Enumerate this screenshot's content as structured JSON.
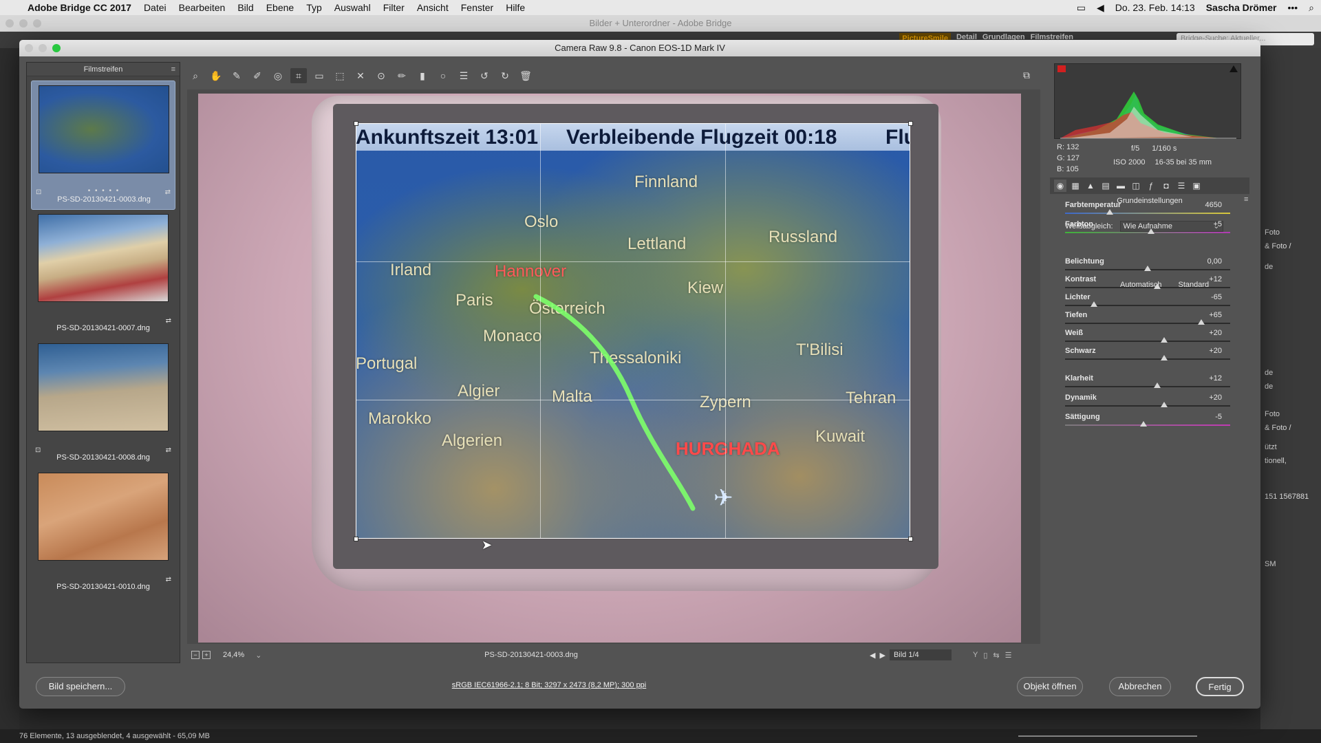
{
  "menubar": {
    "app_name": "Adobe Bridge CC 2017",
    "menus": [
      "Datei",
      "Bearbeiten",
      "Bild",
      "Ebene",
      "Typ",
      "Auswahl",
      "Filter",
      "Ansicht",
      "Fenster",
      "Hilfe"
    ],
    "datetime": "Do. 23. Feb. 14:13",
    "user": "Sascha Drömer"
  },
  "bridge": {
    "window_title": "Bilder + Unterordner - Adobe Bridge",
    "workspaces": [
      "PictureSmile",
      "Detail",
      "Grundlagen",
      "Filmstreifen"
    ],
    "search_placeholder": "Bridge-Suche: Aktueller...",
    "status_text": "76 Elemente, 13 ausgeblendet, 4 ausgewählt - 65,09 MB",
    "right_items": [
      "Foto",
      "& Foto /",
      "de",
      "de",
      "de",
      "Foto",
      "& Foto /",
      "ützt",
      "tionell,",
      "151 1567881",
      "SM"
    ]
  },
  "camera_raw": {
    "window_title": "Camera Raw 9.8 - Canon EOS-1D Mark IV",
    "filmstrip": {
      "title": "Filmstreifen",
      "items": [
        {
          "filename": "PS-SD-20130421-0003.dng",
          "dots": "• • • • •"
        },
        {
          "filename": "PS-SD-20130421-0007.dng"
        },
        {
          "filename": "PS-SD-20130421-0008.dng"
        },
        {
          "filename": "PS-SD-20130421-0010.dng"
        }
      ]
    },
    "preview": {
      "map_header_left": "Ankunftszeit 13:01",
      "map_header_right": "Verbleibende Flugzeit 00:18",
      "map_header_cut": "Flu",
      "labels": [
        "Finnland",
        "Oslo",
        "Lettland",
        "Russland",
        "Irland",
        "Hannover",
        "Paris",
        "Österreich",
        "Kiew",
        "Monaco",
        "Thessaloniki",
        "T'Bilisi",
        "Portugal",
        "Algier",
        "Malta",
        "Zypern",
        "Tehran",
        "Marokko",
        "Algerien",
        "HURGHADA",
        "Kuwait"
      ]
    },
    "status": {
      "zoom": "24,4%",
      "filename": "PS-SD-20130421-0003.dng",
      "image_counter": "Bild 1/4"
    },
    "bottom": {
      "save_label": "Bild speichern...",
      "workflow_options": "sRGB IEC61966-2.1; 8 Bit; 3297 x 2473 (8,2 MP); 300 ppi",
      "open_label": "Objekt öffnen",
      "cancel_label": "Abbrechen",
      "done_label": "Fertig"
    },
    "readout": {
      "r": "R:  132",
      "g": "G:  127",
      "b": "B:  105",
      "aperture": "f/5",
      "shutter": "1/160 s",
      "iso": "ISO 2000",
      "lens": "16-35 bei 35 mm"
    },
    "panel": {
      "title": "Grundeinstellungen",
      "wb_label": "Weißabgleich:",
      "wb_value": "Wie Aufnahme",
      "auto_label": "Automatisch",
      "default_label": "Standard",
      "sliders": [
        {
          "label": "Farbtemperatur",
          "value": "4650",
          "pos": 0.27
        },
        {
          "label": "Farbton",
          "value": "+5",
          "pos": 0.52
        },
        {
          "label": "Belichtung",
          "value": "0,00",
          "pos": 0.5
        },
        {
          "label": "Kontrast",
          "value": "+12",
          "pos": 0.56
        },
        {
          "label": "Lichter",
          "value": "-65",
          "pos": 0.175
        },
        {
          "label": "Tiefen",
          "value": "+65",
          "pos": 0.825
        },
        {
          "label": "Weiß",
          "value": "+20",
          "pos": 0.6
        },
        {
          "label": "Schwarz",
          "value": "+20",
          "pos": 0.6
        },
        {
          "label": "Klarheit",
          "value": "+12",
          "pos": 0.56
        },
        {
          "label": "Dynamik",
          "value": "+20",
          "pos": 0.6
        },
        {
          "label": "Sättigung",
          "value": "-5",
          "pos": 0.475
        }
      ]
    },
    "colors": {
      "accent_orange": "#e8a000",
      "close": "#ff5f57",
      "minimize": "#febc2e",
      "maximize": "#28c840"
    }
  }
}
